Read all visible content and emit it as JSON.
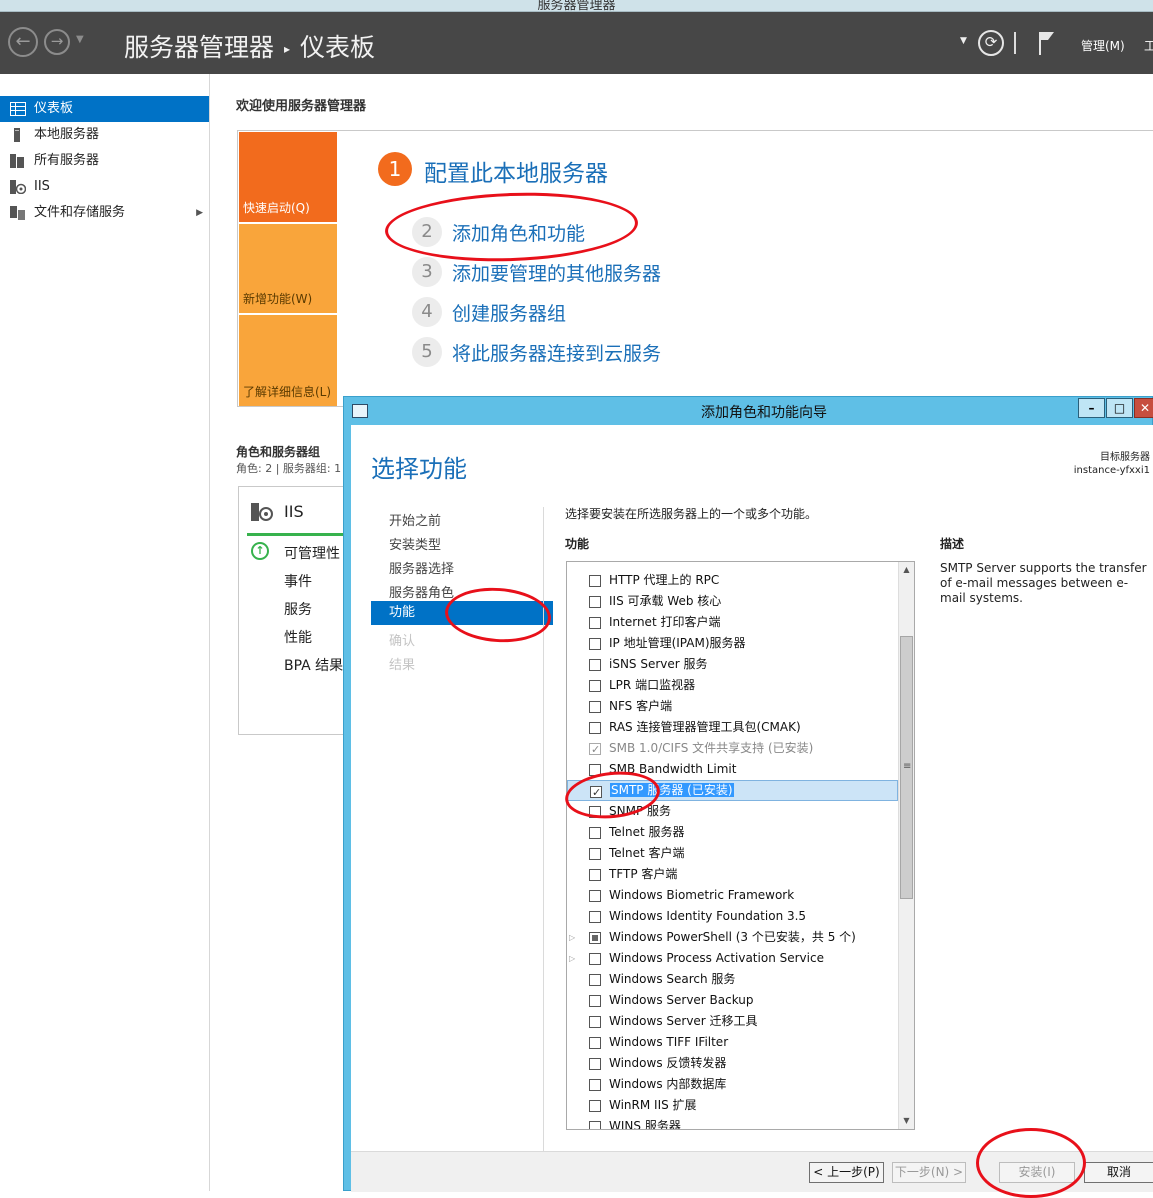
{
  "os_window": {
    "title": "服务器管理器"
  },
  "header": {
    "app_name": "服务器管理器",
    "separator": "▸",
    "page": "仪表板",
    "manage_menu": "管理(M)",
    "tools_menu": "工"
  },
  "sidebar": {
    "items": [
      {
        "label": "仪表板",
        "icon": "dashboard-icon",
        "active": true
      },
      {
        "label": "本地服务器",
        "icon": "server-icon"
      },
      {
        "label": "所有服务器",
        "icon": "servers-icon"
      },
      {
        "label": "IIS",
        "icon": "iis-icon"
      },
      {
        "label": "文件和存储服务",
        "icon": "storage-icon",
        "has_submenu": true
      }
    ]
  },
  "main": {
    "welcome_title": "欢迎使用服务器管理器",
    "tiles": [
      "快速启动(Q)",
      "新增功能(W)",
      "了解详细信息(L)"
    ],
    "steps": [
      {
        "num": "1",
        "text": "配置此本地服务器"
      },
      {
        "num": "2",
        "text": "添加角色和功能"
      },
      {
        "num": "3",
        "text": "添加要管理的其他服务器"
      },
      {
        "num": "4",
        "text": "创建服务器组"
      },
      {
        "num": "5",
        "text": "将此服务器连接到云服务"
      }
    ],
    "roles_title": "角色和服务器组",
    "roles_sub": "角色: 2 | 服务器组: 1",
    "iis_card": {
      "title": "IIS",
      "rows": [
        "可管理性",
        "事件",
        "服务",
        "性能",
        "BPA 结果"
      ]
    }
  },
  "wizard": {
    "title": "添加角色和功能向导",
    "heading": "选择功能",
    "target_label": "目标服务器",
    "target_server": "instance-yfxxi1",
    "steps": [
      {
        "label": "开始之前",
        "state": "normal"
      },
      {
        "label": "安装类型",
        "state": "normal"
      },
      {
        "label": "服务器选择",
        "state": "normal"
      },
      {
        "label": "服务器角色",
        "state": "normal"
      },
      {
        "label": "功能",
        "state": "active"
      },
      {
        "label": "确认",
        "state": "disabled"
      },
      {
        "label": "结果",
        "state": "disabled"
      }
    ],
    "instruction": "选择要安装在所选服务器上的一个或多个功能。",
    "features_header": "功能",
    "description_header": "描述",
    "description": "SMTP Server supports the transfer of e-mail messages between e-mail systems.",
    "features": [
      {
        "label": "HTTP 代理上的 RPC",
        "state": "unchecked"
      },
      {
        "label": "IIS 可承载 Web 核心",
        "state": "unchecked"
      },
      {
        "label": "Internet 打印客户端",
        "state": "unchecked"
      },
      {
        "label": "IP 地址管理(IPAM)服务器",
        "state": "unchecked"
      },
      {
        "label": "iSNS Server 服务",
        "state": "unchecked"
      },
      {
        "label": "LPR 端口监视器",
        "state": "unchecked"
      },
      {
        "label": "NFS 客户端",
        "state": "unchecked"
      },
      {
        "label": "RAS 连接管理器管理工具包(CMAK)",
        "state": "unchecked"
      },
      {
        "label": "SMB 1.0/CIFS 文件共享支持 (已安装)",
        "state": "checked-disabled"
      },
      {
        "label": "SMB Bandwidth Limit",
        "state": "unchecked"
      },
      {
        "label": "SMTP 服务器 (已安装)",
        "state": "checked-selected"
      },
      {
        "label": "SNMP 服务",
        "state": "unchecked"
      },
      {
        "label": "Telnet 服务器",
        "state": "unchecked"
      },
      {
        "label": "Telnet 客户端",
        "state": "unchecked"
      },
      {
        "label": "TFTP 客户端",
        "state": "unchecked"
      },
      {
        "label": "Windows Biometric Framework",
        "state": "unchecked"
      },
      {
        "label": "Windows Identity Foundation 3.5",
        "state": "unchecked"
      },
      {
        "label": "Windows PowerShell (3 个已安装，共 5 个)",
        "state": "partial",
        "expandable": true
      },
      {
        "label": "Windows Process Activation Service",
        "state": "unchecked",
        "expandable": true
      },
      {
        "label": "Windows Search 服务",
        "state": "unchecked"
      },
      {
        "label": "Windows Server Backup",
        "state": "unchecked"
      },
      {
        "label": "Windows Server 迁移工具",
        "state": "unchecked"
      },
      {
        "label": "Windows TIFF IFilter",
        "state": "unchecked"
      },
      {
        "label": "Windows 反馈转发器",
        "state": "unchecked"
      },
      {
        "label": "Windows 内部数据库",
        "state": "unchecked"
      },
      {
        "label": "WinRM IIS 扩展",
        "state": "unchecked"
      },
      {
        "label": "WINS 服务器",
        "state": "unchecked"
      }
    ],
    "buttons": {
      "prev": "< 上一步(P)",
      "next": "下一步(N) >",
      "install": "安装(I)",
      "cancel": "取消"
    }
  },
  "colors": {
    "accent_blue": "#0072c6",
    "quick_start_orange": "#f26b1d",
    "tile_orange": "#f9a53b",
    "annotation_red": "#e8101a"
  }
}
